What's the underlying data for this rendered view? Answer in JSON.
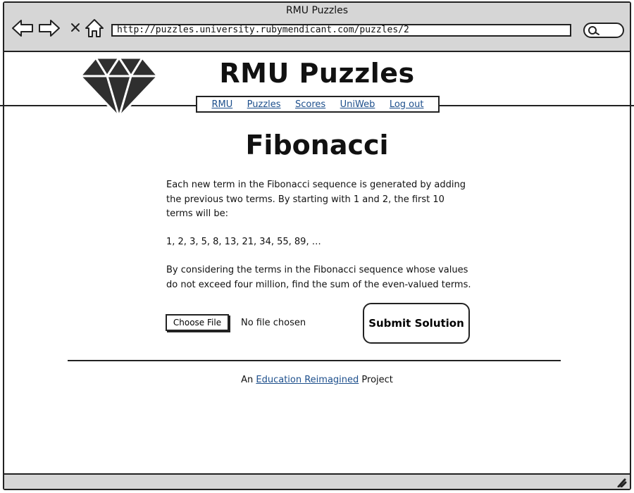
{
  "window": {
    "title": "RMU Puzzles"
  },
  "toolbar": {
    "icons": [
      "back-arrow-icon",
      "forward-arrow-icon",
      "close-x-icon",
      "home-icon",
      "search-icon"
    ],
    "url": "http://puzzles.university.rubymendicant.com/puzzles/2"
  },
  "site": {
    "logo": "gem-icon",
    "title": "RMU Puzzles",
    "nav": [
      "RMU",
      "Puzzles",
      "Scores",
      "UniWeb",
      "Log out"
    ]
  },
  "puzzle": {
    "title": "Fibonacci",
    "paragraph1": "Each new term in the Fibonacci sequence is generated by adding the previous two terms. By starting with 1 and 2, the first 10 terms will be:",
    "sequence": "1, 2, 3, 5, 8, 13, 21, 34, 55, 89, …",
    "paragraph2": "By considering the terms in the Fibonacci sequence whose values do not exceed four million, find the sum of the even-valued terms."
  },
  "form": {
    "choose_file_label": "Choose File",
    "file_status": "No file chosen",
    "submit_label": "Submit Solution"
  },
  "footer": {
    "prefix": "An",
    "link": "Education Reimagined",
    "suffix": "Project"
  },
  "colors": {
    "chrome": "#d6d6d6",
    "link": "#1d4f8c",
    "ink": "#222222"
  }
}
